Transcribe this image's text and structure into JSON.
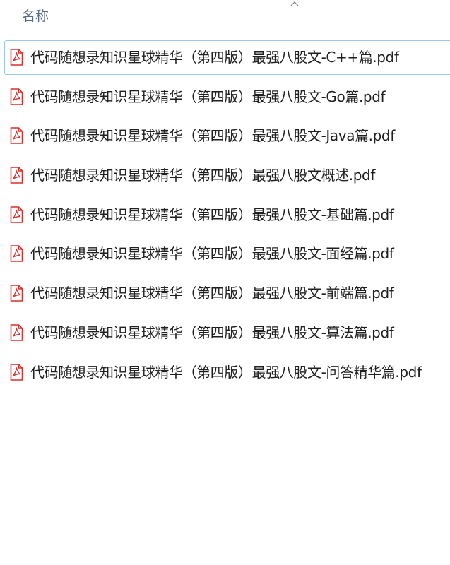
{
  "header": {
    "name_column_label": "名称",
    "sort_icon": "chevron-up-icon"
  },
  "files": [
    {
      "name": "代码随想录知识星球精华（第四版）最强八股文-C++篇.pdf",
      "icon": "pdf-file-icon",
      "selected": true
    },
    {
      "name": "代码随想录知识星球精华（第四版）最强八股文-Go篇.pdf",
      "icon": "pdf-file-icon",
      "selected": false
    },
    {
      "name": "代码随想录知识星球精华（第四版）最强八股文-Java篇.pdf",
      "icon": "pdf-file-icon",
      "selected": false
    },
    {
      "name": "代码随想录知识星球精华（第四版）最强八股文概述.pdf",
      "icon": "pdf-file-icon",
      "selected": false
    },
    {
      "name": "代码随想录知识星球精华（第四版）最强八股文-基础篇.pdf",
      "icon": "pdf-file-icon",
      "selected": false
    },
    {
      "name": "代码随想录知识星球精华（第四版）最强八股文-面经篇.pdf",
      "icon": "pdf-file-icon",
      "selected": false
    },
    {
      "name": "代码随想录知识星球精华（第四版）最强八股文-前端篇.pdf",
      "icon": "pdf-file-icon",
      "selected": false
    },
    {
      "name": "代码随想录知识星球精华（第四版）最强八股文-算法篇.pdf",
      "icon": "pdf-file-icon",
      "selected": false
    },
    {
      "name": "代码随想录知识星球精华（第四版）最强八股文-问答精华篇.pdf",
      "icon": "pdf-file-icon",
      "selected": false
    }
  ],
  "colors": {
    "selection_border": "#99c9ea",
    "pdf_red": "#d9302c",
    "header_text": "#5a6a85",
    "file_text": "#1f1f1f"
  }
}
